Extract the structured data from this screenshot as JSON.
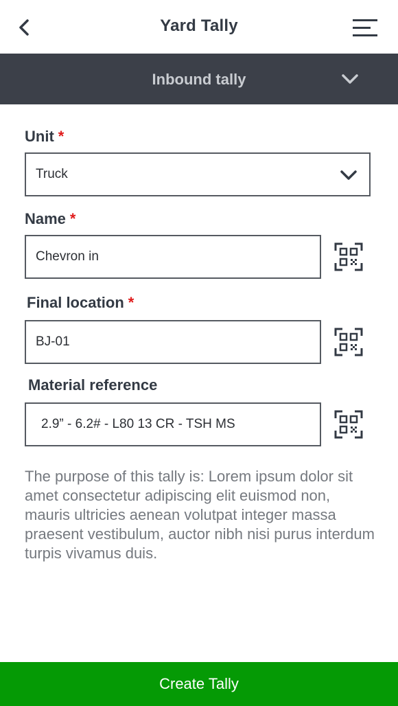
{
  "header": {
    "title": "Yard Tally",
    "back_icon": "chevron-left-icon",
    "menu_icon": "hamburger-menu-icon"
  },
  "section": {
    "title": "Inbound tally",
    "toggle_icon": "chevron-down-icon"
  },
  "form": {
    "unit": {
      "label": "Unit",
      "required_mark": "*",
      "value": "Truck"
    },
    "name": {
      "label": "Name",
      "required_mark": "*",
      "value": "Chevron in",
      "scan_icon": "qr-code-icon"
    },
    "final_location": {
      "label": "Final location",
      "required_mark": "*",
      "value": "BJ-01",
      "scan_icon": "qr-code-icon"
    },
    "material_reference": {
      "label": "Material reference",
      "value": "2.9” - 6.2# - L80 13 CR - TSH MS",
      "scan_icon": "qr-code-icon"
    }
  },
  "description": "The purpose of this tally is: Lorem ipsum dolor sit amet consectetur adipiscing elit euismod non, mauris ultricies aenean volutpat integer massa praesent vestibulum, auctor nibh nisi purus interdum turpis vivamus duis.",
  "actions": {
    "create_label": "Create Tally"
  },
  "colors": {
    "section_bar": "#3c4049",
    "primary_button": "#059a05",
    "required": "#e01b1b",
    "text": "#333a44"
  }
}
